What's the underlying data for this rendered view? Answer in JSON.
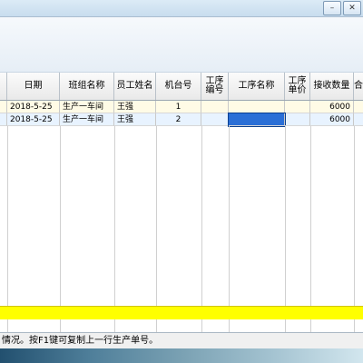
{
  "window": {
    "title": "",
    "controls": {
      "minimize": "–",
      "maximize": "□",
      "close": "✕"
    }
  },
  "table": {
    "columns": [
      "日期",
      "班组名称",
      "员工姓名",
      "机台号",
      "工序\n编号",
      "工序名称",
      "工序\n单价",
      "接收数量",
      "合"
    ],
    "rows": [
      [
        "2018-5-25",
        "生产一车间",
        "王强",
        "1",
        "",
        "",
        "",
        "6000"
      ],
      [
        "2018-5-25",
        "生产一车间",
        "王强",
        "2",
        "",
        "",
        "",
        "6000"
      ]
    ]
  },
  "status": {
    "text": "情况。按F1键可复制上一行生产单号。"
  },
  "colors": {
    "sum_bar": "#ffff00",
    "row1": "#fffbe6",
    "row2": "#e8f3ff",
    "selected": "#2b6fd6"
  }
}
